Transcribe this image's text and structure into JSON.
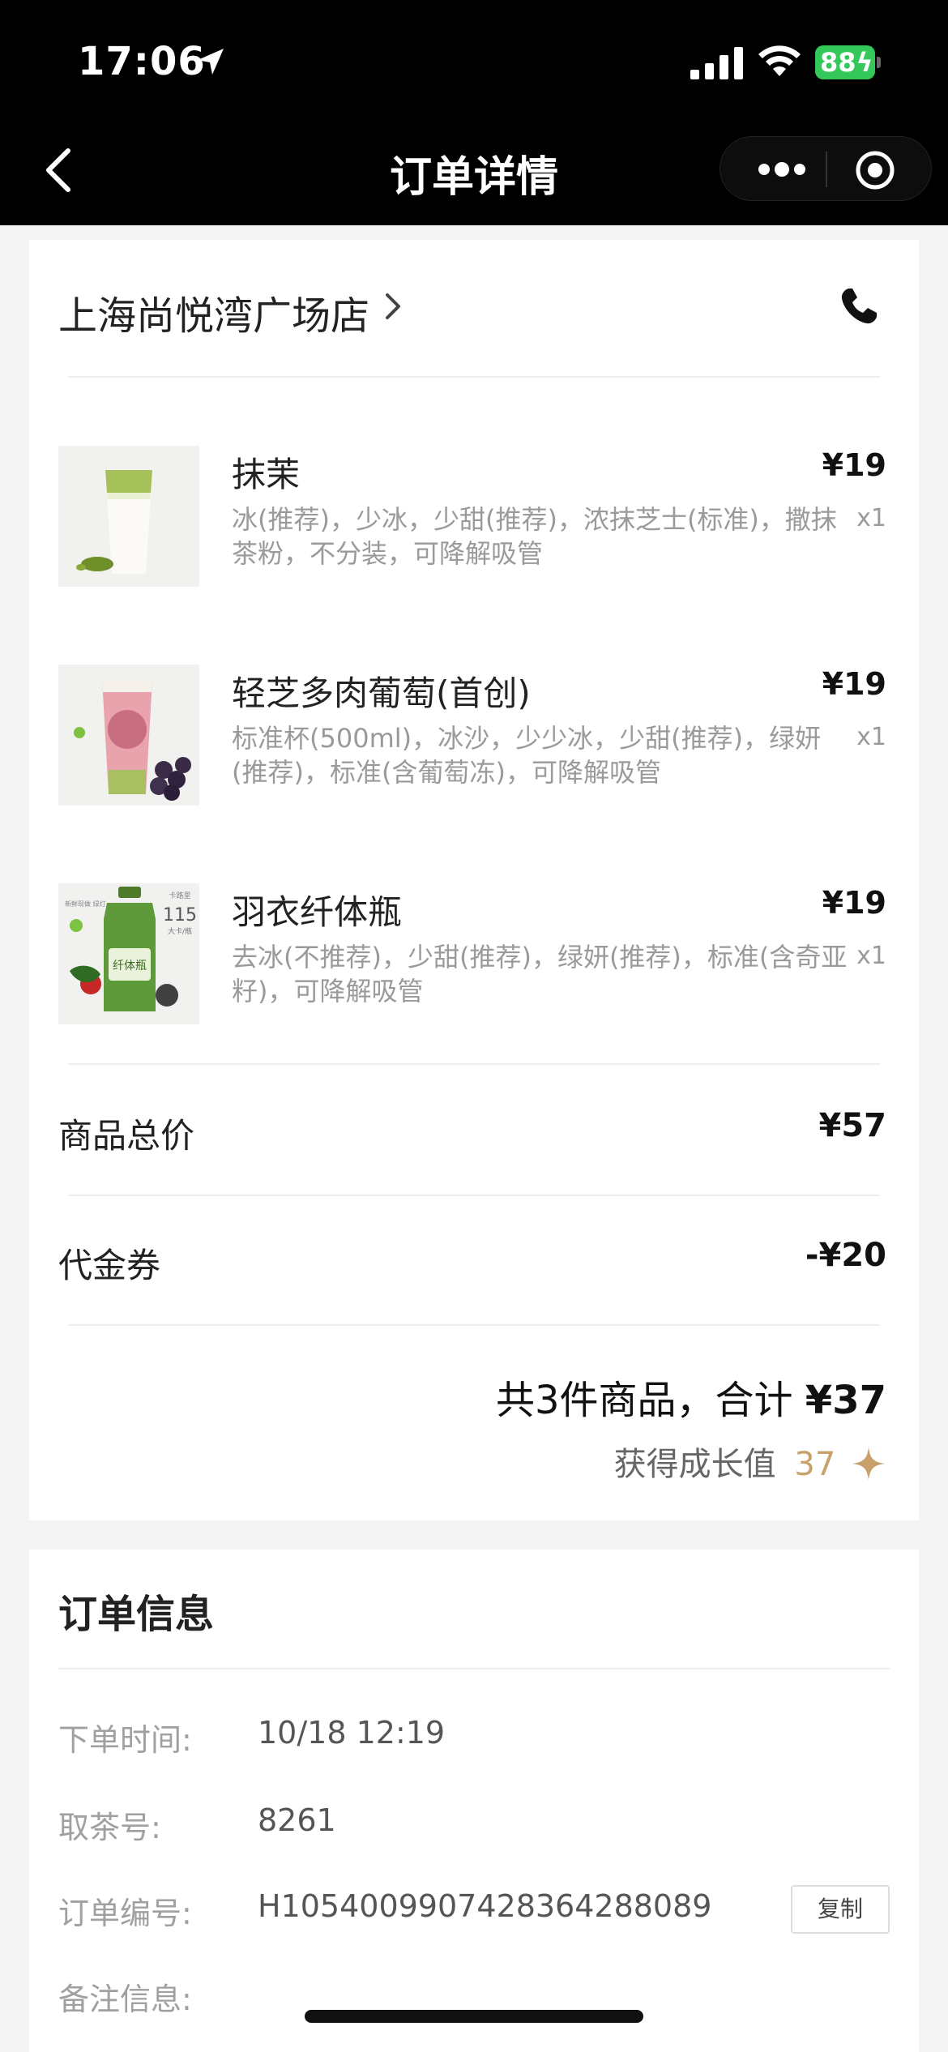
{
  "status_bar": {
    "time": "17:06",
    "battery": "88"
  },
  "nav": {
    "title": "订单详情"
  },
  "store": {
    "name": "上海尚悦湾广场店"
  },
  "items": [
    {
      "name": "抹茉",
      "options": "冰(推荐)，少冰，少甜(推荐)，浓抹芝士(标准)，撒抹茶粉，不分装，可降解吸管",
      "price": "¥19",
      "qty": "x1",
      "image": "matcha-tea-image"
    },
    {
      "name": "轻芝多肉葡萄(首创)",
      "options": "标准杯(500ml)，冰沙，少少冰，少甜(推荐)，绿妍(推荐)，标准(含葡萄冻)，可降解吸管",
      "price": "¥19",
      "qty": "x1",
      "image": "grape-tea-image"
    },
    {
      "name": "羽衣纤体瓶",
      "options": "去冰(不推荐)，少甜(推荐)，绿妍(推荐)，标准(含奇亚籽)，可降解吸管",
      "price": "¥19",
      "qty": "x1",
      "image": "kale-bottle-image",
      "image_text": {
        "left": "新鲜现做 绿灯",
        "top": "卡路里",
        "big": "115",
        "unit": "大卡/瓶",
        "label": "纤体瓶"
      }
    }
  ],
  "summary": {
    "subtotal_label": "商品总价",
    "subtotal_value": "¥57",
    "voucher_label": "代金券",
    "voucher_value": "-¥20",
    "total_prefix": "共3件商品，合计",
    "total_amount": "¥37",
    "growth_label": "获得成长值",
    "growth_value": "37"
  },
  "order_info": {
    "title": "订单信息",
    "time_label": "下单时间:",
    "time_value": "10/18 12:19",
    "pickup_label": "取茶号:",
    "pickup_value": "8261",
    "order_no_label": "订单编号:",
    "order_no_value": "H1054009907428364288089",
    "copy_label": "复制",
    "note_label": "备注信息:"
  },
  "colors": {
    "accent_gold": "#c8a06a",
    "battery_green": "#34c759"
  }
}
